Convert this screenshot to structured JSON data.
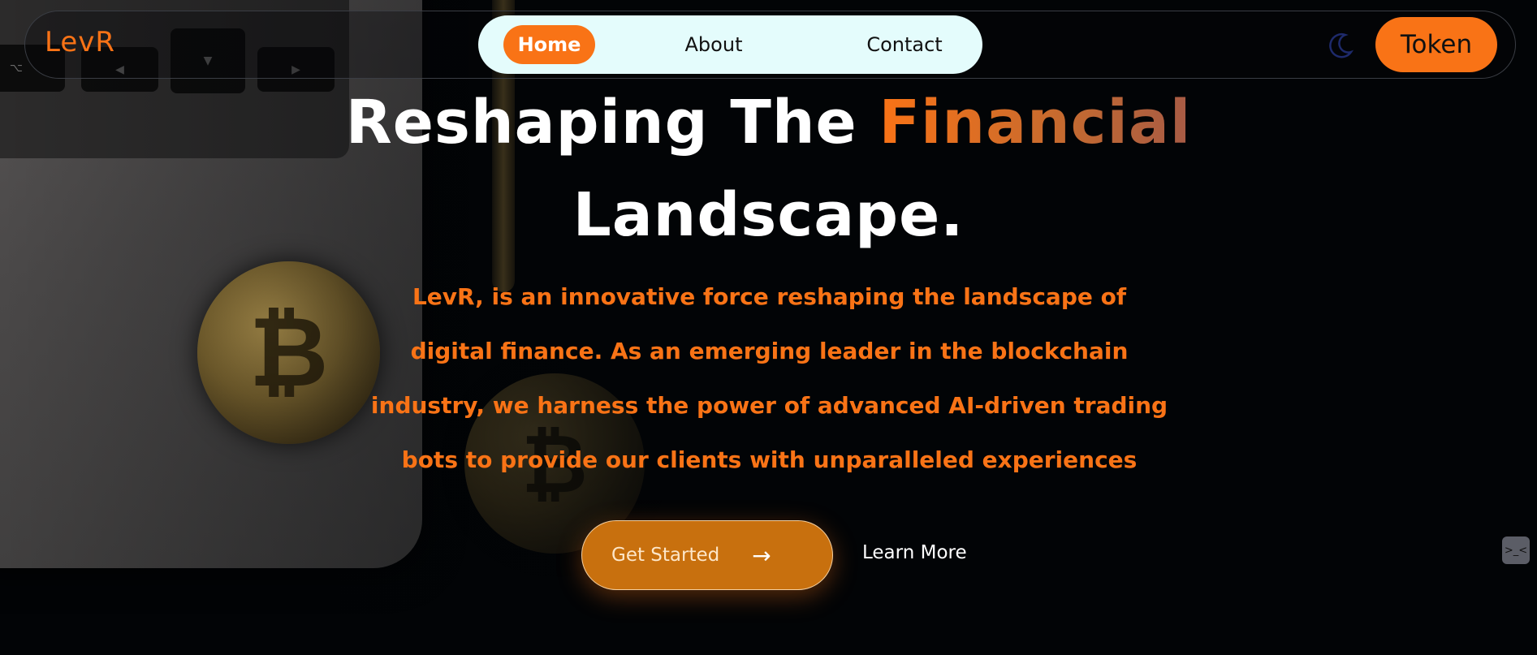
{
  "brand": {
    "logo": "LevR",
    "accent_color": "#f97316"
  },
  "nav": {
    "links": [
      {
        "label": "Home",
        "active": true
      },
      {
        "label": "About",
        "active": false
      },
      {
        "label": "Contact",
        "active": false
      }
    ],
    "theme_toggle_icon": "moon-icon",
    "token_label": "Token"
  },
  "hero": {
    "title_part1": "Reshaping The ",
    "title_accent": "Financial",
    "title_line2": "Landscape.",
    "description": "LevR, is an innovative force reshaping the landscape of digital finance. As an emerging leader in the blockchain industry, we harness the power of advanced AI-driven trading bots to provide our clients with unparalleled experiences",
    "primary_cta": "Get Started",
    "primary_cta_icon": "arrow-right-icon",
    "secondary_cta": "Learn More"
  },
  "widget": {
    "label": ">_<"
  },
  "keyboard": {
    "keys": [
      "⌥",
      "◀",
      "▼",
      "▶"
    ]
  }
}
